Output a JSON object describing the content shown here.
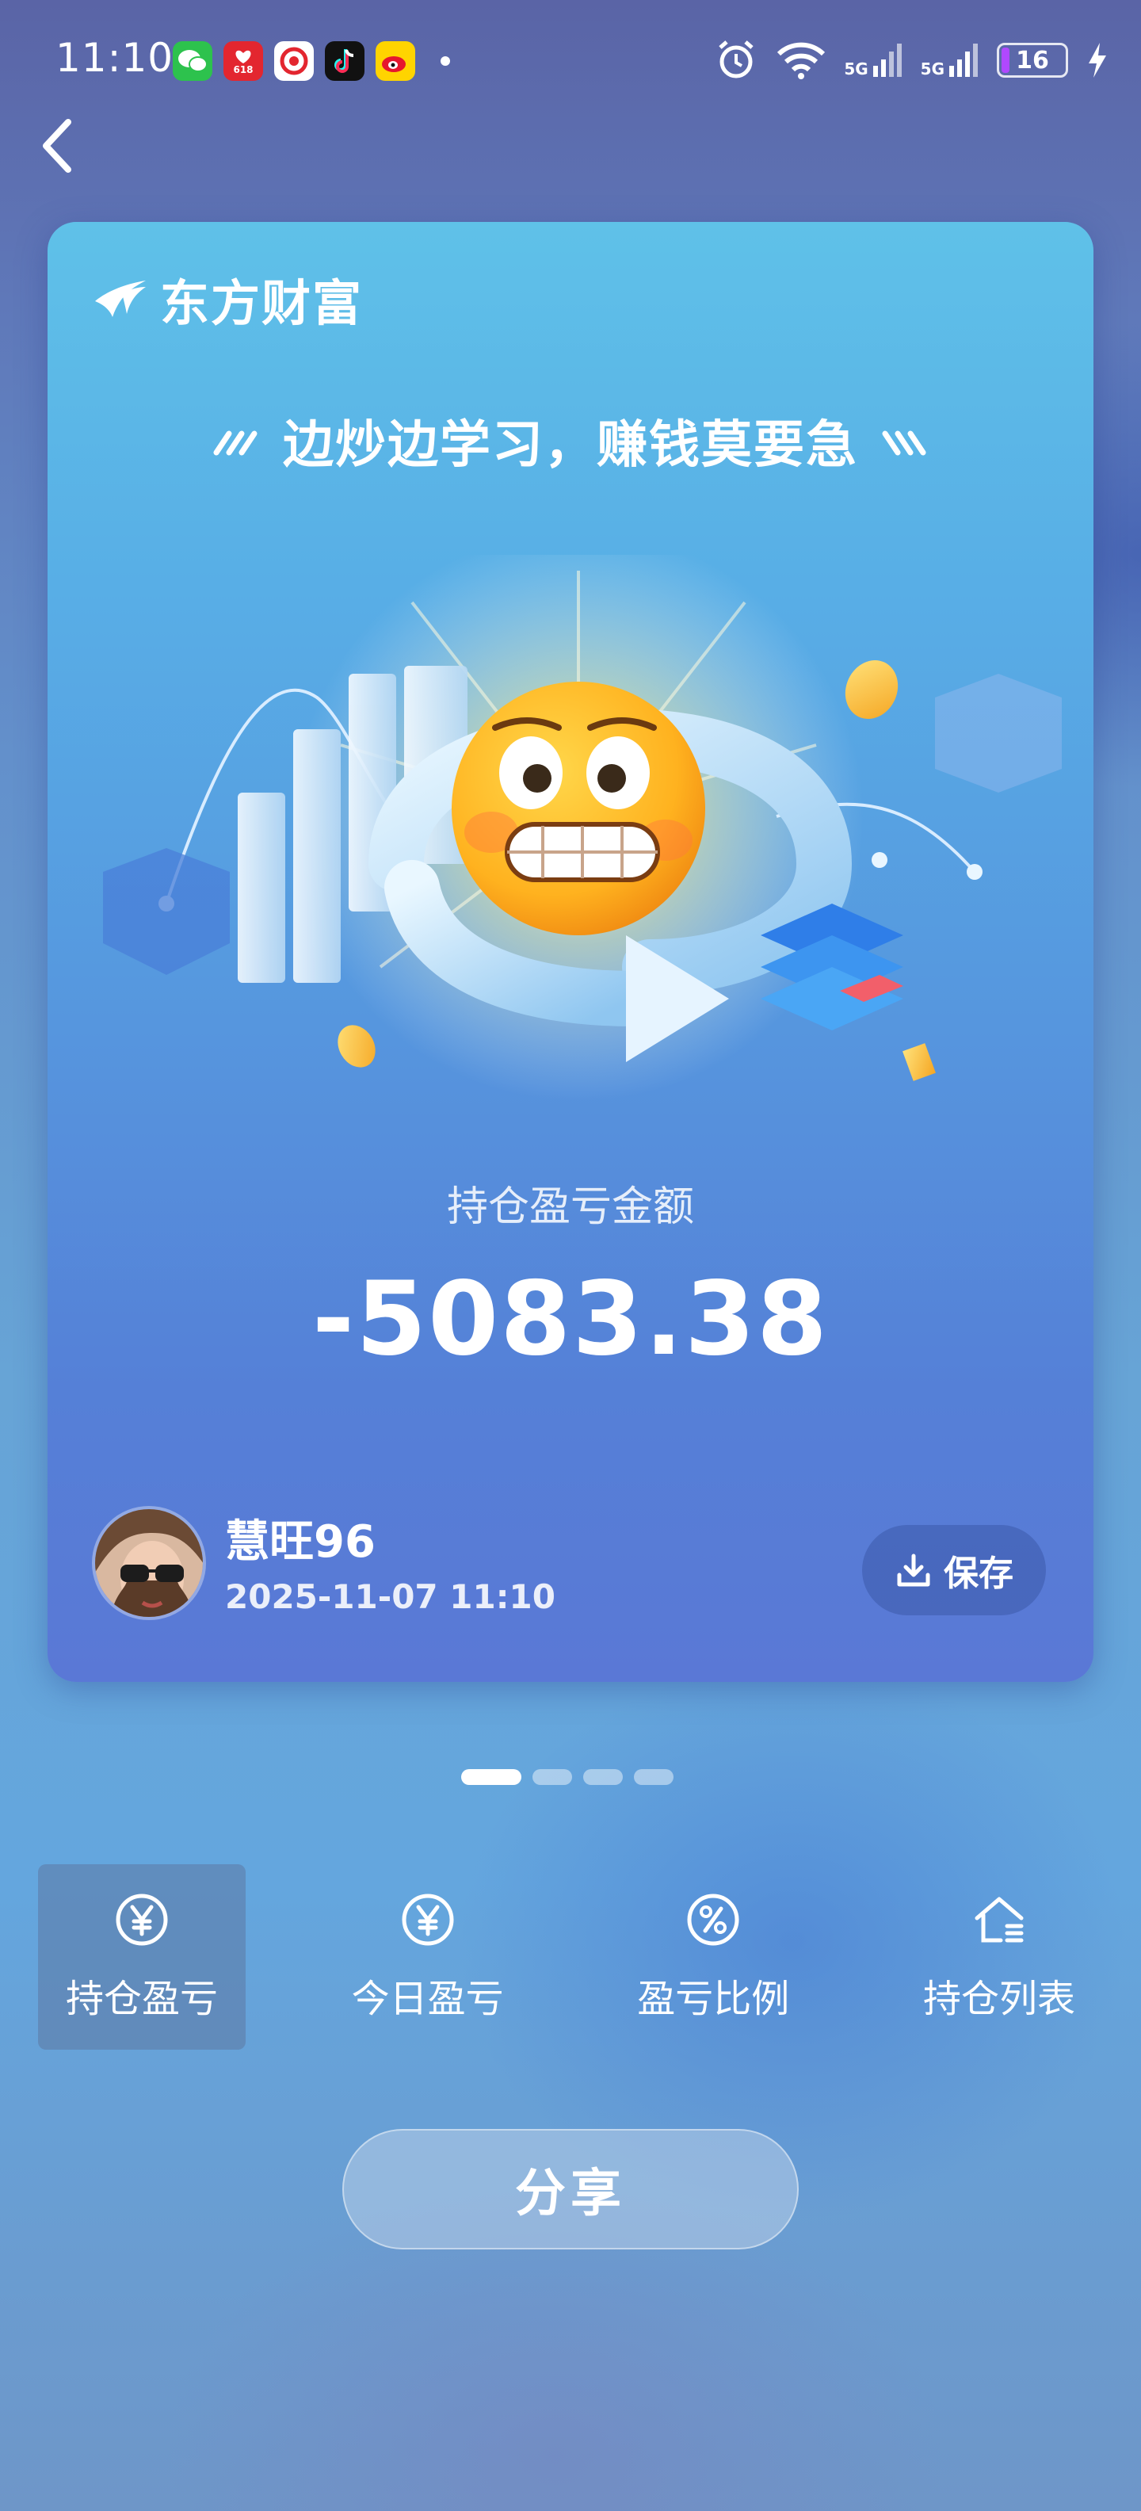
{
  "status_bar": {
    "time": "11:10",
    "app_icons": [
      "wechat-icon",
      "jd-618-icon",
      "netease-icon",
      "tiktok-icon",
      "weibo-icon"
    ],
    "jd_badge": "618",
    "signal_1": "5G",
    "signal_2": "5G",
    "battery": "16"
  },
  "card": {
    "brand": "东方财富",
    "slogan": "边炒边学习，赚钱莫要急",
    "pl_label": "持仓盈亏金额",
    "pl_amount": "-5083.38",
    "username": "慧旺96",
    "timestamp": "2025-11-07 11:10",
    "save_label": "保存"
  },
  "pager": {
    "count": 4,
    "active": 0
  },
  "tabs": [
    {
      "label": "持仓盈亏",
      "icon": "yen-circle-icon",
      "active": true
    },
    {
      "label": "今日盈亏",
      "icon": "yen-circle-icon",
      "active": false
    },
    {
      "label": "盈亏比例",
      "icon": "percent-circle-icon",
      "active": false
    },
    {
      "label": "持仓列表",
      "icon": "house-list-icon",
      "active": false
    }
  ],
  "share_label": "分享",
  "colors": {
    "accent_battery": "#b048ff",
    "card_top": "#5fc1e8",
    "card_bottom": "#5a78d6"
  }
}
